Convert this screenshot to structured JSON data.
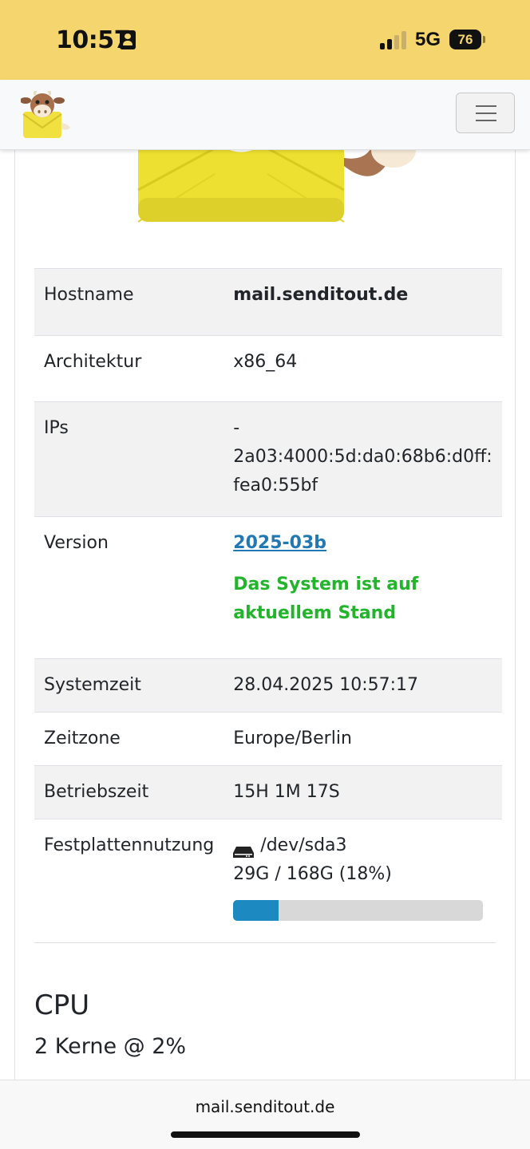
{
  "status_bar": {
    "time": "10:57",
    "network": "5G",
    "battery": "76"
  },
  "navbar": {
    "logo_icon": "mailcow-logo",
    "menu_icon": "hamburger-menu-icon"
  },
  "system_info": {
    "rows": [
      {
        "key": "Hostname",
        "value": "mail.senditout.de"
      },
      {
        "key": "Architektur",
        "value": "x86_64"
      },
      {
        "key": "IPs",
        "value_lines": [
          "-",
          "2a03:4000:5d:da0:68b6:d0ff:",
          "fea0:55bf"
        ]
      },
      {
        "key": "Version",
        "link": "2025-03b",
        "status_lines": [
          "Das System ist auf",
          "aktuellem Stand"
        ]
      },
      {
        "key": "Systemzeit",
        "value": "28.04.2025 10:57:17"
      },
      {
        "key": "Zeitzone",
        "value": "Europe/Berlin"
      },
      {
        "key": "Betriebszeit",
        "value": "15H 1M 17S"
      },
      {
        "key": "Festplattennutzung",
        "device": "/dev/sda3",
        "usage": "29G / 168G (18%)",
        "usage_fraction": 0.18
      }
    ]
  },
  "cpu": {
    "title": "CPU",
    "summary": "2 Kerne @ 2%"
  },
  "browser": {
    "url": "mail.senditout.de"
  },
  "colors": {
    "status_bar_bg": "#f5d56e",
    "link": "#2179b4",
    "ok": "#22b42a",
    "progress": "#1c8ac0"
  }
}
